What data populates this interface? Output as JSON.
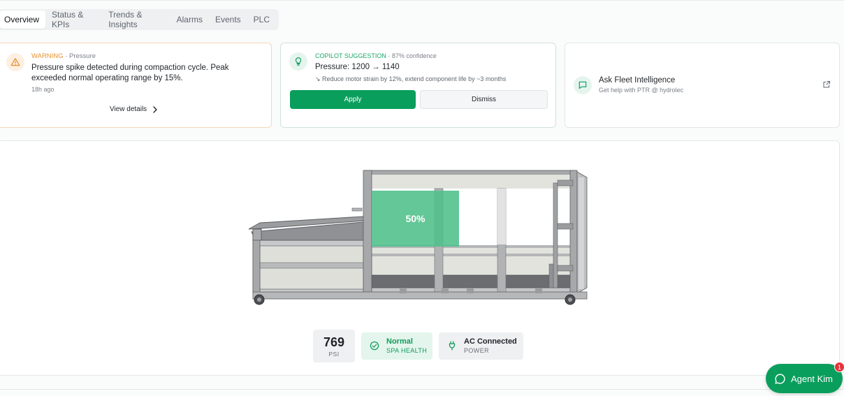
{
  "tabs": [
    {
      "label": "Overview",
      "active": true
    },
    {
      "label": "Status & KPIs",
      "active": false
    },
    {
      "label": "Trends & Insights",
      "active": false
    },
    {
      "label": "Alarms",
      "active": false
    },
    {
      "label": "Events",
      "active": false
    },
    {
      "label": "PLC",
      "active": false
    }
  ],
  "warning_card": {
    "level": "WARNING",
    "category": "· Pressure",
    "message": "Pressure spike detected during compaction cycle. Peak exceeded normal operating range by 15%.",
    "time": "18h ago",
    "link_label": "View details",
    "icon": "warning-triangle-icon",
    "accent": "#e8912d"
  },
  "copilot_card": {
    "label": "COPILOT SUGGESTION",
    "confidence": "· 87% confidence",
    "title": "Pressure: 1200 → 1140",
    "detail": "↘ Reduce motor strain by 12%, extend component life by ~3 months",
    "apply_label": "Apply",
    "dismiss_label": "Dismiss",
    "icon": "lightbulb-icon",
    "accent": "#0a9e5d"
  },
  "fleet_card": {
    "title": "Ask Fleet Intelligence",
    "subtitle": "Get help with PTR @ hydrolec",
    "icon": "chat-icon",
    "action_icon": "external-link-icon"
  },
  "machine": {
    "fill_percent": 50,
    "fill_label": "50%",
    "fill_color": "#4fbf8a"
  },
  "stats": {
    "pressure_value": "769",
    "pressure_unit": "PSI",
    "health_value": "Normal",
    "health_label": "SPA HEALTH",
    "power_value": "AC Connected",
    "power_label": "POWER"
  },
  "agent": {
    "label": "Agent Kim",
    "badge": "1",
    "color": "#0a9e5d"
  }
}
